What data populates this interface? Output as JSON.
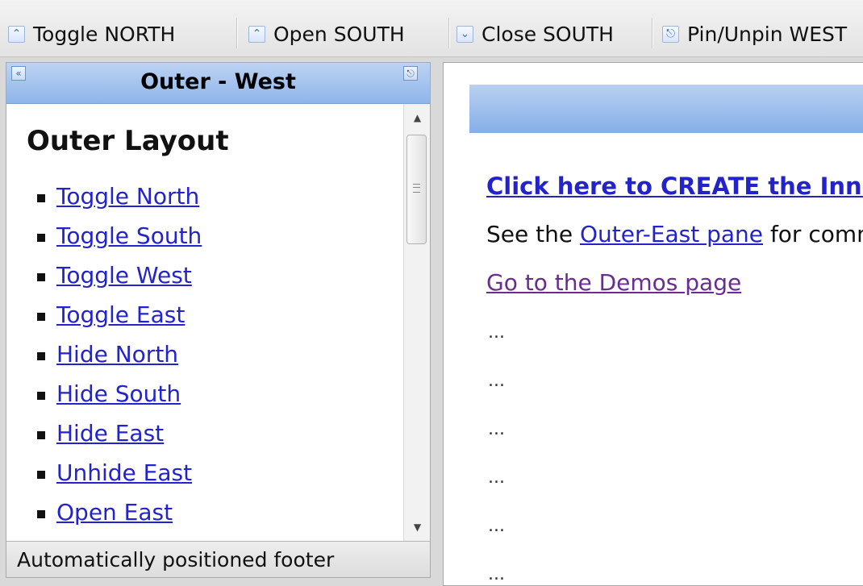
{
  "toolbar": {
    "buttons": [
      {
        "label": "Toggle NORTH",
        "icon": "chevron-double-up-icon"
      },
      {
        "label": "Open SOUTH",
        "icon": "chevron-double-up-icon"
      },
      {
        "label": "Close SOUTH",
        "icon": "chevron-double-down-icon"
      },
      {
        "label": "Pin/Unpin WEST",
        "icon": "pin-icon"
      }
    ]
  },
  "west": {
    "title": "Outer - West",
    "heading": "Outer Layout",
    "links": [
      "Toggle North",
      "Toggle South",
      "Toggle West",
      "Toggle East",
      "Hide North",
      "Hide South",
      "Hide East",
      "Unhide East",
      "Open East"
    ],
    "footer": "Automatically positioned footer"
  },
  "center": {
    "create_link": "Click here to CREATE the Inner Layout",
    "see_prefix": "See the",
    "see_link": "Outer-East pane",
    "see_suffix": "for commands",
    "demos_link": "Go to the Demos page",
    "ellipsis": "..."
  },
  "colors": {
    "link": "#2323cc",
    "visited_link": "#6a2c91",
    "header_blue": "#8eb5ea"
  }
}
